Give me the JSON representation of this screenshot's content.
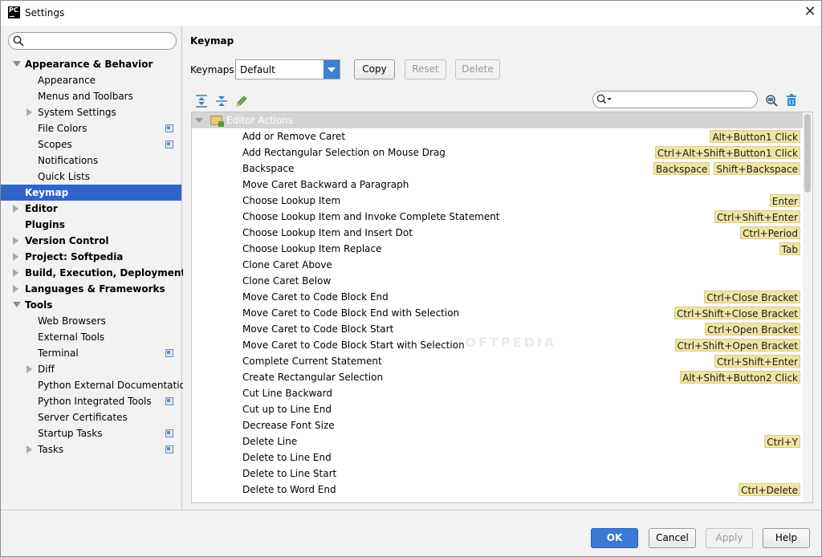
{
  "window": {
    "title": "Settings",
    "app_icon": "PC"
  },
  "sidebar": {
    "search_placeholder": "",
    "items": [
      {
        "label": "Appearance & Behavior",
        "bold": true,
        "level": 0,
        "arrow": "down"
      },
      {
        "label": "Appearance",
        "bold": false,
        "level": 1
      },
      {
        "label": "Menus and Toolbars",
        "bold": false,
        "level": 1
      },
      {
        "label": "System Settings",
        "bold": false,
        "level": 1,
        "arrow": "right"
      },
      {
        "label": "File Colors",
        "bold": false,
        "level": 1,
        "project_icon": true
      },
      {
        "label": "Scopes",
        "bold": false,
        "level": 1,
        "project_icon": true
      },
      {
        "label": "Notifications",
        "bold": false,
        "level": 1
      },
      {
        "label": "Quick Lists",
        "bold": false,
        "level": 1
      },
      {
        "label": "Keymap",
        "bold": true,
        "level": 0,
        "selected": true
      },
      {
        "label": "Editor",
        "bold": true,
        "level": 0,
        "arrow": "right"
      },
      {
        "label": "Plugins",
        "bold": true,
        "level": 0
      },
      {
        "label": "Version Control",
        "bold": true,
        "level": 0,
        "arrow": "right"
      },
      {
        "label": "Project: Softpedia",
        "bold": true,
        "level": 0,
        "arrow": "right"
      },
      {
        "label": "Build, Execution, Deployment",
        "bold": true,
        "level": 0,
        "arrow": "right"
      },
      {
        "label": "Languages & Frameworks",
        "bold": true,
        "level": 0,
        "arrow": "right"
      },
      {
        "label": "Tools",
        "bold": true,
        "level": 0,
        "arrow": "down"
      },
      {
        "label": "Web Browsers",
        "bold": false,
        "level": 1
      },
      {
        "label": "External Tools",
        "bold": false,
        "level": 1
      },
      {
        "label": "Terminal",
        "bold": false,
        "level": 1,
        "project_icon": true
      },
      {
        "label": "Diff",
        "bold": false,
        "level": 1,
        "arrow": "right"
      },
      {
        "label": "Python External Documentation",
        "bold": false,
        "level": 1
      },
      {
        "label": "Python Integrated Tools",
        "bold": false,
        "level": 1,
        "project_icon": true
      },
      {
        "label": "Server Certificates",
        "bold": false,
        "level": 1
      },
      {
        "label": "Startup Tasks",
        "bold": false,
        "level": 1,
        "project_icon": true
      },
      {
        "label": "Tasks",
        "bold": false,
        "level": 1,
        "arrow": "right",
        "project_icon": true
      }
    ]
  },
  "main": {
    "title": "Keymap",
    "keymaps_label": "Keymaps:",
    "keymap_selected": "Default",
    "buttons": {
      "copy": "Copy",
      "reset": "Reset",
      "delete": "Delete"
    },
    "filter_placeholder": "",
    "group_label": "Editor Actions",
    "actions": [
      {
        "name": "Add or Remove Caret",
        "shortcuts": [
          "Alt+Button1 Click"
        ]
      },
      {
        "name": "Add Rectangular Selection on Mouse Drag",
        "shortcuts": [
          "Ctrl+Alt+Shift+Button1 Click"
        ]
      },
      {
        "name": "Backspace",
        "shortcuts": [
          "Backspace",
          "Shift+Backspace"
        ]
      },
      {
        "name": "Move Caret Backward a Paragraph",
        "shortcuts": []
      },
      {
        "name": "Choose Lookup Item",
        "shortcuts": [
          "Enter"
        ]
      },
      {
        "name": "Choose Lookup Item and Invoke Complete Statement",
        "shortcuts": [
          "Ctrl+Shift+Enter"
        ]
      },
      {
        "name": "Choose Lookup Item and Insert Dot",
        "shortcuts": [
          "Ctrl+Period"
        ]
      },
      {
        "name": "Choose Lookup Item Replace",
        "shortcuts": [
          "Tab"
        ]
      },
      {
        "name": "Clone Caret Above",
        "shortcuts": []
      },
      {
        "name": "Clone Caret Below",
        "shortcuts": []
      },
      {
        "name": "Move Caret to Code Block End",
        "shortcuts": [
          "Ctrl+Close Bracket"
        ]
      },
      {
        "name": "Move Caret to Code Block End with Selection",
        "shortcuts": [
          "Ctrl+Shift+Close Bracket"
        ]
      },
      {
        "name": "Move Caret to Code Block Start",
        "shortcuts": [
          "Ctrl+Open Bracket"
        ]
      },
      {
        "name": "Move Caret to Code Block Start with Selection",
        "shortcuts": [
          "Ctrl+Shift+Open Bracket"
        ]
      },
      {
        "name": "Complete Current Statement",
        "shortcuts": [
          "Ctrl+Shift+Enter"
        ]
      },
      {
        "name": "Create Rectangular Selection",
        "shortcuts": [
          "Alt+Shift+Button2 Click"
        ]
      },
      {
        "name": "Cut Line Backward",
        "shortcuts": []
      },
      {
        "name": "Cut up to Line End",
        "shortcuts": []
      },
      {
        "name": "Decrease Font Size",
        "shortcuts": []
      },
      {
        "name": "Delete Line",
        "shortcuts": [
          "Ctrl+Y"
        ]
      },
      {
        "name": "Delete to Line End",
        "shortcuts": []
      },
      {
        "name": "Delete to Line Start",
        "shortcuts": []
      },
      {
        "name": "Delete to Word End",
        "shortcuts": [
          "Ctrl+Delete"
        ]
      }
    ],
    "watermark": "SOFTPEDIA"
  },
  "footer": {
    "ok": "OK",
    "cancel": "Cancel",
    "apply": "Apply",
    "help": "Help"
  },
  "colors": {
    "selection": "#2f65ca",
    "primary_button": "#3b7ad4",
    "shortcut_bg": "#efe4a4",
    "group_row": "#d4d4d4"
  }
}
